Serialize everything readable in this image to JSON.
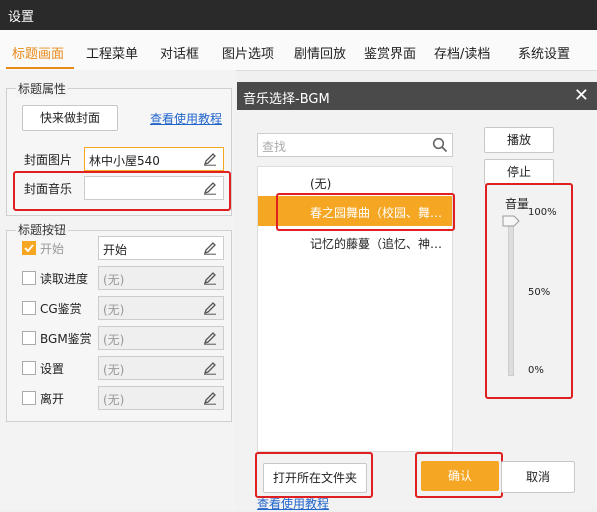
{
  "window": {
    "title": "设置"
  },
  "tabs": [
    "标题画面",
    "工程菜单",
    "对话框",
    "图片选项",
    "剧情回放",
    "鉴赏界面",
    "存档/读档",
    "系统设置"
  ],
  "title_props": {
    "group_title": "标题属性",
    "quick_cover_button": "快来做封面",
    "tutorial_link": "查看使用教程",
    "cover_image_label": "封面图片",
    "cover_image_value": "林中小屋540",
    "cover_music_label": "封面音乐",
    "cover_music_value": ""
  },
  "title_buttons": {
    "group_title": "标题按钮",
    "items": [
      {
        "label": "开始",
        "value": "开始",
        "checked": true
      },
      {
        "label": "读取进度",
        "value": "(无)",
        "checked": false
      },
      {
        "label": "CG鉴赏",
        "value": "(无)",
        "checked": false
      },
      {
        "label": "BGM鉴赏",
        "value": "(无)",
        "checked": false
      },
      {
        "label": "设置",
        "value": "(无)",
        "checked": false
      },
      {
        "label": "离开",
        "value": "(无)",
        "checked": false
      }
    ]
  },
  "dialog": {
    "title": "音乐选择-BGM",
    "close": "✕",
    "search_placeholder": "查找",
    "list": [
      {
        "text": "(无)",
        "selected": false
      },
      {
        "text": "春之园舞曲（校园、舞…",
        "selected": true
      },
      {
        "text": "记忆的藤蔓（追忆、神…",
        "selected": false
      }
    ],
    "play_button": "播放",
    "stop_button": "停止",
    "volume": {
      "label": "音量",
      "ticks": [
        "100%",
        "50%",
        "0%"
      ],
      "level_percent": 100
    },
    "open_folder_button": "打开所在文件夹",
    "confirm_button": "确认",
    "cancel_button": "取消",
    "bottom_link": "查看使用教程"
  },
  "colors": {
    "accent": "#f5a623",
    "highlight": "#e02020",
    "link": "#2266cc",
    "tab_active": "#e88a1a"
  }
}
